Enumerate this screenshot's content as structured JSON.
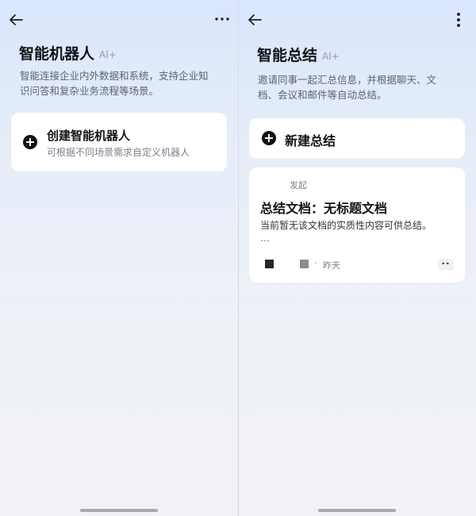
{
  "left": {
    "title": "智能机器人",
    "ai_badge": "AI+",
    "description_lines": [
      "智能连接企业内外数据和系统，支持企业知",
      "识问答和复杂业务流程等场景。"
    ],
    "create_card": {
      "title": "创建智能机器人",
      "subtitle": "可根据不同场景需求自定义机器人"
    }
  },
  "right": {
    "title": "智能总结",
    "ai_badge": "AI+",
    "description_lines": [
      "邀请同事一起汇总信息，并根据聊天、文",
      "档、会议和邮件等自动总结。"
    ],
    "new_summary_label": "新建总结",
    "summary_card": {
      "initiated_label": "发起",
      "title": "总结文档：无标题文档",
      "content": "当前暂无该文档的实质性内容可供总结。",
      "ellipsis": "…",
      "separator": "·",
      "time": "昨天",
      "more_label": "••"
    }
  },
  "colors": {
    "background_top": "#d9e6fb",
    "card": "#ffffff",
    "primary_text": "#121416",
    "secondary_text": "#5c6370",
    "ai_badge": "#8e9bb3"
  },
  "icons": {
    "back": "arrow-left-icon",
    "more_horizontal": "more-horizontal-icon",
    "more_vertical": "more-vertical-icon",
    "plus": "plus-circle-icon"
  }
}
